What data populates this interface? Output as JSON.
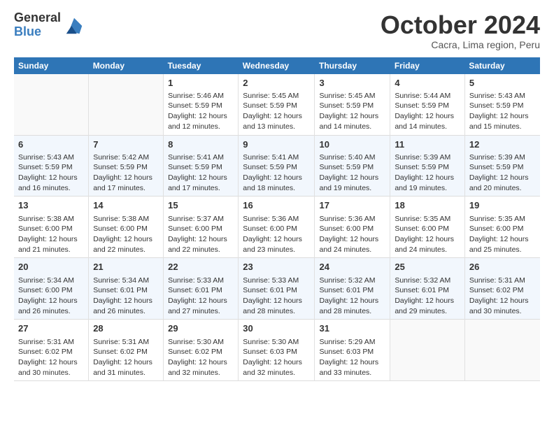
{
  "logo": {
    "general": "General",
    "blue": "Blue"
  },
  "title": "October 2024",
  "location": "Cacra, Lima region, Peru",
  "header_days": [
    "Sunday",
    "Monday",
    "Tuesday",
    "Wednesday",
    "Thursday",
    "Friday",
    "Saturday"
  ],
  "weeks": [
    [
      {
        "day": "",
        "info": ""
      },
      {
        "day": "",
        "info": ""
      },
      {
        "day": "1",
        "info": "Sunrise: 5:46 AM\nSunset: 5:59 PM\nDaylight: 12 hours and 12 minutes."
      },
      {
        "day": "2",
        "info": "Sunrise: 5:45 AM\nSunset: 5:59 PM\nDaylight: 12 hours and 13 minutes."
      },
      {
        "day": "3",
        "info": "Sunrise: 5:45 AM\nSunset: 5:59 PM\nDaylight: 12 hours and 14 minutes."
      },
      {
        "day": "4",
        "info": "Sunrise: 5:44 AM\nSunset: 5:59 PM\nDaylight: 12 hours and 14 minutes."
      },
      {
        "day": "5",
        "info": "Sunrise: 5:43 AM\nSunset: 5:59 PM\nDaylight: 12 hours and 15 minutes."
      }
    ],
    [
      {
        "day": "6",
        "info": "Sunrise: 5:43 AM\nSunset: 5:59 PM\nDaylight: 12 hours and 16 minutes."
      },
      {
        "day": "7",
        "info": "Sunrise: 5:42 AM\nSunset: 5:59 PM\nDaylight: 12 hours and 17 minutes."
      },
      {
        "day": "8",
        "info": "Sunrise: 5:41 AM\nSunset: 5:59 PM\nDaylight: 12 hours and 17 minutes."
      },
      {
        "day": "9",
        "info": "Sunrise: 5:41 AM\nSunset: 5:59 PM\nDaylight: 12 hours and 18 minutes."
      },
      {
        "day": "10",
        "info": "Sunrise: 5:40 AM\nSunset: 5:59 PM\nDaylight: 12 hours and 19 minutes."
      },
      {
        "day": "11",
        "info": "Sunrise: 5:39 AM\nSunset: 5:59 PM\nDaylight: 12 hours and 19 minutes."
      },
      {
        "day": "12",
        "info": "Sunrise: 5:39 AM\nSunset: 5:59 PM\nDaylight: 12 hours and 20 minutes."
      }
    ],
    [
      {
        "day": "13",
        "info": "Sunrise: 5:38 AM\nSunset: 6:00 PM\nDaylight: 12 hours and 21 minutes."
      },
      {
        "day": "14",
        "info": "Sunrise: 5:38 AM\nSunset: 6:00 PM\nDaylight: 12 hours and 22 minutes."
      },
      {
        "day": "15",
        "info": "Sunrise: 5:37 AM\nSunset: 6:00 PM\nDaylight: 12 hours and 22 minutes."
      },
      {
        "day": "16",
        "info": "Sunrise: 5:36 AM\nSunset: 6:00 PM\nDaylight: 12 hours and 23 minutes."
      },
      {
        "day": "17",
        "info": "Sunrise: 5:36 AM\nSunset: 6:00 PM\nDaylight: 12 hours and 24 minutes."
      },
      {
        "day": "18",
        "info": "Sunrise: 5:35 AM\nSunset: 6:00 PM\nDaylight: 12 hours and 24 minutes."
      },
      {
        "day": "19",
        "info": "Sunrise: 5:35 AM\nSunset: 6:00 PM\nDaylight: 12 hours and 25 minutes."
      }
    ],
    [
      {
        "day": "20",
        "info": "Sunrise: 5:34 AM\nSunset: 6:00 PM\nDaylight: 12 hours and 26 minutes."
      },
      {
        "day": "21",
        "info": "Sunrise: 5:34 AM\nSunset: 6:01 PM\nDaylight: 12 hours and 26 minutes."
      },
      {
        "day": "22",
        "info": "Sunrise: 5:33 AM\nSunset: 6:01 PM\nDaylight: 12 hours and 27 minutes."
      },
      {
        "day": "23",
        "info": "Sunrise: 5:33 AM\nSunset: 6:01 PM\nDaylight: 12 hours and 28 minutes."
      },
      {
        "day": "24",
        "info": "Sunrise: 5:32 AM\nSunset: 6:01 PM\nDaylight: 12 hours and 28 minutes."
      },
      {
        "day": "25",
        "info": "Sunrise: 5:32 AM\nSunset: 6:01 PM\nDaylight: 12 hours and 29 minutes."
      },
      {
        "day": "26",
        "info": "Sunrise: 5:31 AM\nSunset: 6:02 PM\nDaylight: 12 hours and 30 minutes."
      }
    ],
    [
      {
        "day": "27",
        "info": "Sunrise: 5:31 AM\nSunset: 6:02 PM\nDaylight: 12 hours and 30 minutes."
      },
      {
        "day": "28",
        "info": "Sunrise: 5:31 AM\nSunset: 6:02 PM\nDaylight: 12 hours and 31 minutes."
      },
      {
        "day": "29",
        "info": "Sunrise: 5:30 AM\nSunset: 6:02 PM\nDaylight: 12 hours and 32 minutes."
      },
      {
        "day": "30",
        "info": "Sunrise: 5:30 AM\nSunset: 6:03 PM\nDaylight: 12 hours and 32 minutes."
      },
      {
        "day": "31",
        "info": "Sunrise: 5:29 AM\nSunset: 6:03 PM\nDaylight: 12 hours and 33 minutes."
      },
      {
        "day": "",
        "info": ""
      },
      {
        "day": "",
        "info": ""
      }
    ]
  ]
}
